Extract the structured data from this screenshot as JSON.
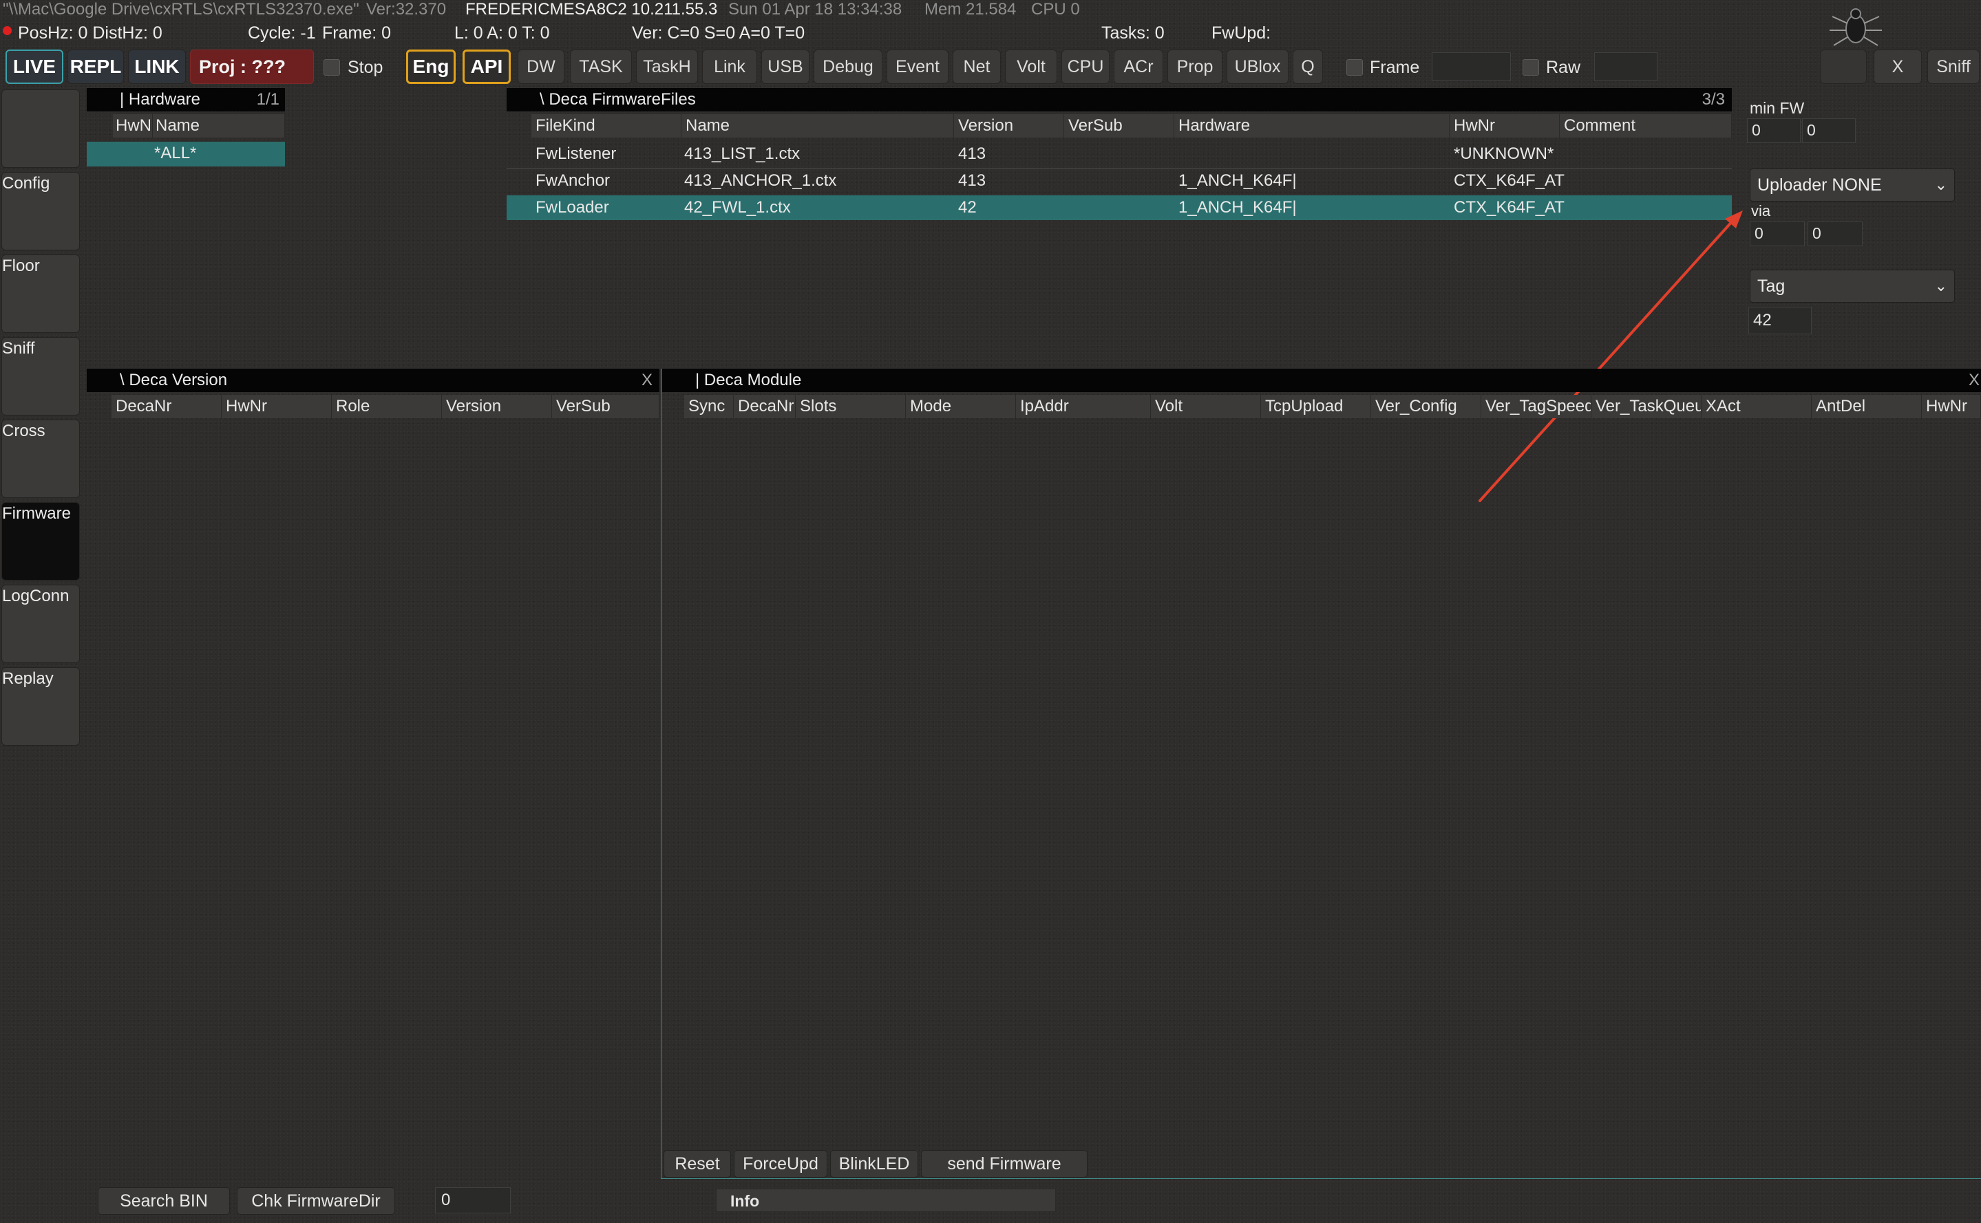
{
  "status": {
    "path": "\"\\\\Mac\\Google Drive\\cxRTLS\\cxRTLS32370.exe\"",
    "version": "Ver:32.370",
    "host": "FREDERICMESA8C2 10.211.55.3",
    "datetime": "Sun 01 Apr 18 13:34:38",
    "mem": "Mem 21.584",
    "cpu": "CPU 0",
    "poshz": "PosHz: 0 DistHz: 0",
    "cycle": "Cycle: -1",
    "frame": "Frame: 0",
    "lat": "L: 0  A: 0  T: 0",
    "ver_counts": "Ver: C=0 S=0 A=0 T=0",
    "tasks": "Tasks: 0",
    "fwupd": "FwUpd:"
  },
  "toolbar": {
    "live": "LIVE",
    "repl": "REPL",
    "link": "LINK",
    "proj": "Proj : ???",
    "stop": "Stop",
    "eng": "Eng",
    "api": "API",
    "buttons": [
      "DW",
      "TASK",
      "TaskH",
      "Link",
      "USB",
      "Debug",
      "Event",
      "Net",
      "Volt",
      "CPU",
      "ACr",
      "Prop",
      "UBlox",
      "Q"
    ],
    "frame": "Frame",
    "raw": "Raw",
    "close": "X",
    "sniff": "Sniff"
  },
  "sidebar": [
    "Config",
    "Floor",
    "Sniff",
    "Cross",
    "Firmware",
    "LogConn",
    "Replay"
  ],
  "hardware": {
    "title": "| Hardware",
    "count": "1/1",
    "col1": "HwNr",
    "col2": "Name",
    "row": "*ALL*"
  },
  "firmware": {
    "title": "\\ Deca FirmwareFiles",
    "count": "3/3",
    "headers": [
      "FileKind",
      "Name",
      "Version",
      "VerSub",
      "Hardware",
      "HwNr",
      "Comment"
    ],
    "rows": [
      [
        "FwListener",
        "413_LIST_1.ctx",
        "413",
        "",
        "",
        "*UNKNOWN*",
        ""
      ],
      [
        "FwAnchor",
        "413_ANCHOR_1.ctx",
        "413",
        "",
        "1_ANCH_K64F|",
        "CTX_K64F_AT",
        ""
      ],
      [
        "FwLoader",
        "42_FWL_1.ctx",
        "42",
        "",
        "1_ANCH_K64F|",
        "CTX_K64F_AT",
        ""
      ]
    ]
  },
  "right": {
    "min_fw": "min FW",
    "min_a": "0",
    "min_b": "0",
    "uploader": "Uploader NONE",
    "via": "via",
    "via_a": "0",
    "via_b": "0",
    "tag": "Tag",
    "value": "42"
  },
  "version_panel": {
    "title": "\\ Deca Version",
    "close": "X",
    "headers": [
      "DecaNr",
      "HwNr",
      "Role",
      "Version",
      "VerSub"
    ]
  },
  "module_panel": {
    "title": "| Deca Module",
    "close": "X",
    "headers": [
      "Sync",
      "DecaNr",
      "Slots",
      "Mode",
      "IpAddr",
      "Volt",
      "TcpUpload",
      "Ver_Config",
      "Ver_TagSpeed",
      "Ver_TaskQueue",
      "XAct",
      "AntDel",
      "HwNr"
    ],
    "actions": [
      "Reset",
      "ForceUpd",
      "BlinkLED",
      "send Firmware"
    ]
  },
  "bottom": {
    "search_bin": "Search BIN",
    "chk_dir": "Chk FirmwareDir",
    "count": "0",
    "info": "Info"
  },
  "colors": {
    "accent": "#2a6f6d",
    "arrow": "#e0402c",
    "gold": "#e0a11c",
    "proj": "#6e1f1f"
  }
}
